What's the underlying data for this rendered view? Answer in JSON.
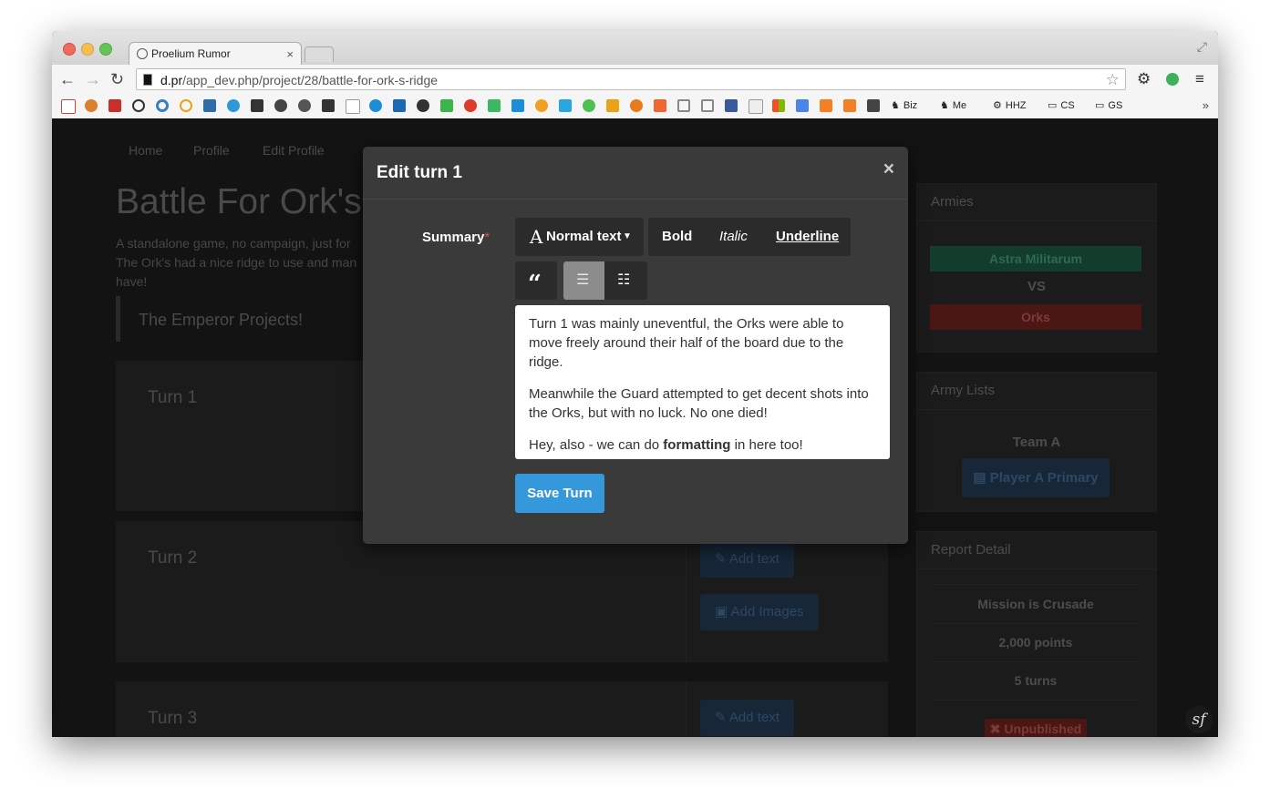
{
  "browser": {
    "tab_title": "Proelium Rumor",
    "tab_close": "×",
    "url_host": "d.pr",
    "url_path": "/app_dev.php/project/28/battle-for-ork-s-ridge",
    "bookmark_folders": [
      "Biz",
      "Me",
      "HHZ",
      "CS",
      "GS"
    ]
  },
  "nav": {
    "items": [
      "Home",
      "Profile",
      "Edit Profile"
    ]
  },
  "page": {
    "title": "Battle For Ork's",
    "description": "A standalone game, no campaign, just for the Ork's had a nice ridge to use and man have!",
    "desc_lines": [
      "A standalone game, no campaign, just for",
      "The Ork's had a nice ridge to use and man",
      "have!"
    ],
    "project_name": "The Emperor Projects!",
    "turns": [
      {
        "title": "Turn 1"
      },
      {
        "title": "Turn 2",
        "add_text": "Add text",
        "add_images": "Add Images"
      },
      {
        "title": "Turn 3",
        "add_text": "Add text"
      }
    ]
  },
  "sidebar": {
    "armies": {
      "heading": "Armies",
      "army_a": "Astra Militarum",
      "vs": "VS",
      "army_b": "Orks"
    },
    "army_lists": {
      "heading": "Army Lists",
      "team": "Team A",
      "primary_button": "Player A Primary"
    },
    "report_detail": {
      "heading": "Report Detail",
      "mission": "Mission is Crusade",
      "points": "2,000 points",
      "turns": "5 turns",
      "status": "Unpublished"
    }
  },
  "modal": {
    "title": "Edit turn 1",
    "close": "×",
    "summary_label": "Summary",
    "required_mark": "*",
    "toolbar": {
      "text_style": "Normal text",
      "bold": "Bold",
      "italic": "Italic",
      "underline": "Underline"
    },
    "editor_paragraphs": [
      "Turn 1 was mainly uneventful, the Orks were able to move freely around their half of the board due to the ridge.",
      "Meanwhile the Guard attempted to get decent shots into the Orks, but with no luck. No one died!"
    ],
    "editor_last_pre": "Hey, also - we can do ",
    "editor_last_bold": "formatting",
    "editor_last_post": " in here too!",
    "save_button": "Save Turn"
  },
  "colors": {
    "accent": "#3498db",
    "army_a_bg": "#123d2c",
    "army_b_bg": "#4b1714"
  }
}
